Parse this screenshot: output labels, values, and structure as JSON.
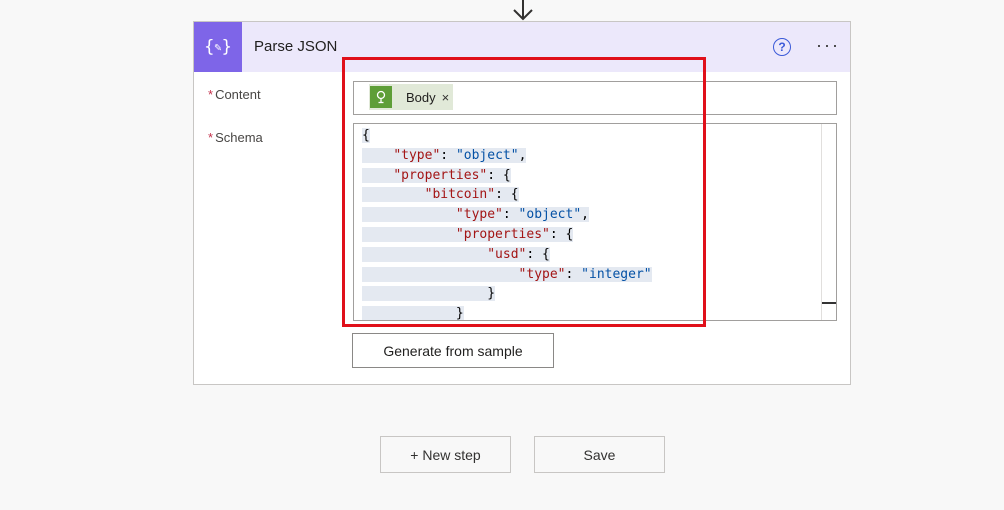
{
  "icons": {
    "down_arrow": "arrow-down-icon",
    "action": "json-braces-icon",
    "help": "help-icon",
    "more": "more-options-icon",
    "token": "http-request-icon",
    "remove": "close-icon"
  },
  "colors": {
    "action_icon_bg": "#7e65e8",
    "header_bg": "#ece8fb",
    "token_bg": "#e1e9d8",
    "token_icon_bg": "#5e9e37",
    "highlight": "#e0101a"
  },
  "card": {
    "title": "Parse JSON",
    "help_glyph": "?",
    "more_glyph": "···"
  },
  "fields": {
    "content": {
      "required_mark": "*",
      "label": "Content",
      "token_label": "Body",
      "token_remove": "×"
    },
    "schema": {
      "required_mark": "*",
      "label": "Schema",
      "code_lines": [
        [
          {
            "t": "{"
          }
        ],
        [
          {
            "t": "    "
          },
          {
            "t": "\"type\"",
            "c": "k"
          },
          {
            "t": ": "
          },
          {
            "t": "\"object\"",
            "c": "s"
          },
          {
            "t": ","
          }
        ],
        [
          {
            "t": "    "
          },
          {
            "t": "\"properties\"",
            "c": "k"
          },
          {
            "t": ": {"
          }
        ],
        [
          {
            "t": "        "
          },
          {
            "t": "\"bitcoin\"",
            "c": "k"
          },
          {
            "t": ": {"
          }
        ],
        [
          {
            "t": "            "
          },
          {
            "t": "\"type\"",
            "c": "k"
          },
          {
            "t": ": "
          },
          {
            "t": "\"object\"",
            "c": "s"
          },
          {
            "t": ","
          }
        ],
        [
          {
            "t": "            "
          },
          {
            "t": "\"properties\"",
            "c": "k"
          },
          {
            "t": ": {"
          }
        ],
        [
          {
            "t": "                "
          },
          {
            "t": "\"usd\"",
            "c": "k"
          },
          {
            "t": ": {"
          }
        ],
        [
          {
            "t": "                    "
          },
          {
            "t": "\"type\"",
            "c": "k"
          },
          {
            "t": ": "
          },
          {
            "t": "\"integer\"",
            "c": "s"
          }
        ],
        [
          {
            "t": "                "
          },
          {
            "t": "}"
          }
        ],
        [
          {
            "t": "            "
          },
          {
            "t": "}"
          }
        ]
      ]
    },
    "generate_label": "Generate from sample"
  },
  "footer": {
    "new_step_label": "+ New step",
    "save_label": "Save"
  }
}
